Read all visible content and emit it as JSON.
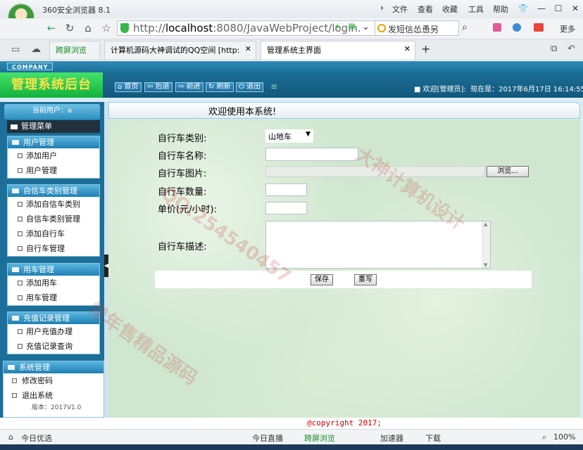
{
  "browser": {
    "name": "360安全浏览器 8.1",
    "menu": [
      "文件",
      "查看",
      "收藏",
      "工具",
      "帮助"
    ],
    "url_prefix": "http://",
    "url_host": "localhost",
    "url_rest": ":8080/JavaWebProject/login.",
    "search_placeholder": "发短信怂恿另",
    "right_tools": "更多",
    "tabs": [
      {
        "label": "跨屏浏览"
      },
      {
        "label": "计算机源码大神调试的QQ空间 [http:"
      },
      {
        "label": "管理系统主界面"
      }
    ],
    "new_tab": "+"
  },
  "app": {
    "logo": "COMPANY",
    "title": "管理系统后台",
    "nav": [
      "首页",
      "后退",
      "前进",
      "刷新",
      "退出"
    ],
    "welcome": "欢迎[管理员]:",
    "now_label": "现在是：",
    "now_value": "2017年6月17日  16:14:55",
    "current_user": "当前用户：a",
    "menu_title": "管理菜单",
    "main_title": "欢迎使用本系统!",
    "groups": [
      {
        "title": "用户管理",
        "items": [
          "添加用户",
          "用户管理"
        ]
      },
      {
        "title": "自信车类别管理",
        "items": [
          "添加自信车类别",
          "自信车类别管理",
          "添加自行车",
          "自行车管理"
        ]
      },
      {
        "title": "用车管理",
        "items": [
          "添加用车",
          "用车管理"
        ]
      },
      {
        "title": "充值记录管理",
        "items": [
          "用户充值办理",
          "充值记录查询"
        ]
      },
      {
        "title": "系统管理",
        "items": [
          "修改密码",
          "退出系统"
        ]
      }
    ],
    "version": "版本：2017V1.0",
    "footer": "@copyright 2017;"
  },
  "form": {
    "type_label": "自行车类别:",
    "type_value": "山地车",
    "name_label": "自行车名称:",
    "name_value": "",
    "image_label": "自行车图片:",
    "browse_label": "浏览...",
    "quantity_label": "自行车数量:",
    "quantity_value": "",
    "price_label": "单价(元/小时):",
    "price_value": "",
    "desc_label": "自行车描述:",
    "save_label": "保存",
    "reset_label": "重写"
  },
  "statusbar": {
    "left": "今日优选",
    "items": [
      "今日直播",
      "跨屏浏览",
      "加速器",
      "下载"
    ],
    "zoom": "100%"
  },
  "watermark": [
    "大神计算机设计",
    "QQ:254540457",
    "常年售精品源码"
  ]
}
